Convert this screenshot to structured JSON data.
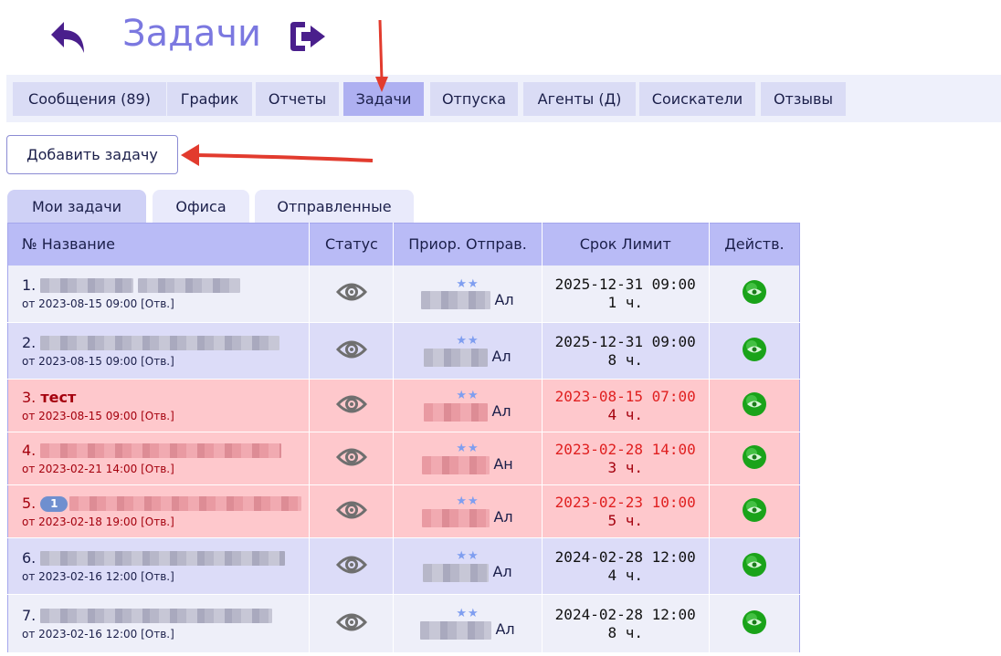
{
  "header": {
    "title": "Задачи",
    "back_icon": "undo-arrow-icon",
    "exit_icon": "logout-icon",
    "accent_color": "#7b78e0",
    "icon_color": "#4a1f8c"
  },
  "nav": [
    {
      "label": "Сообщения (89)",
      "active": false
    },
    {
      "label": "График",
      "active": false
    },
    {
      "label": "Отчеты",
      "active": false
    },
    {
      "label": "Задачи",
      "active": true
    },
    {
      "label": "Отпуска",
      "active": false
    },
    {
      "label": "Агенты (Д)",
      "active": false
    },
    {
      "label": "Соискатели",
      "active": false
    },
    {
      "label": "Отзывы",
      "active": false
    }
  ],
  "add_task_label": "Добавить задачу",
  "tabs": [
    {
      "label": "Мои задачи",
      "active": true
    },
    {
      "label": "Офиса",
      "active": false
    },
    {
      "label": "Отправленные",
      "active": false
    }
  ],
  "table": {
    "headers": [
      "№ Название",
      "Статус",
      "Приор. Отправ.",
      "Срок Лимит",
      "Действ."
    ],
    "rows": [
      {
        "num": "1.",
        "title": "",
        "created": "от 2023-08-15 09:00 [Отв.]",
        "stars": "★★",
        "sender_suffix": "Ал",
        "deadline": "2025-12-31 09:00",
        "limit": "1 ч.",
        "style": "a"
      },
      {
        "num": "2.",
        "title": "",
        "created": "от 2023-08-15 09:00 [Отв.]",
        "stars": "★★",
        "sender_suffix": "Ал",
        "deadline": "2025-12-31 09:00",
        "limit": "8 ч.",
        "style": "b"
      },
      {
        "num": "3.",
        "title": "тест",
        "created": "от 2023-08-15 09:00 [Отв.]",
        "stars": "★★",
        "sender_suffix": "Ал",
        "deadline": "2023-08-15 07:00",
        "limit": "4 ч.",
        "style": "red"
      },
      {
        "num": "4.",
        "title": "",
        "created": "от 2023-02-21 14:00 [Отв.]",
        "stars": "★★",
        "sender_suffix": "Ан",
        "deadline": "2023-02-28 14:00",
        "limit": "3 ч.",
        "style": "red"
      },
      {
        "num": "5.",
        "badge": "1",
        "title": "",
        "created": "от 2023-02-18 19:00 [Отв.]",
        "stars": "★★",
        "sender_suffix": "Ал",
        "deadline": "2023-02-23 10:00",
        "limit": "5 ч.",
        "style": "red"
      },
      {
        "num": "6.",
        "title": "",
        "created": "от 2023-02-16 12:00 [Отв.]",
        "stars": "★★",
        "sender_suffix": "Ал",
        "deadline": "2024-02-28 12:00",
        "limit": "4 ч.",
        "style": "b"
      },
      {
        "num": "7.",
        "title": "",
        "created": "от 2023-02-16 12:00 [Отв.]",
        "stars": "★★",
        "sender_suffix": "Ал",
        "deadline": "2024-02-28 12:00",
        "limit": "8 ч.",
        "style": "a"
      }
    ]
  },
  "colors": {
    "overdue": "#e02020",
    "overdue_row": "#fec8cc",
    "header_row": "#b9bbf6",
    "action_green": "#1aa31a",
    "annotation_arrow": "#e23b2e"
  }
}
